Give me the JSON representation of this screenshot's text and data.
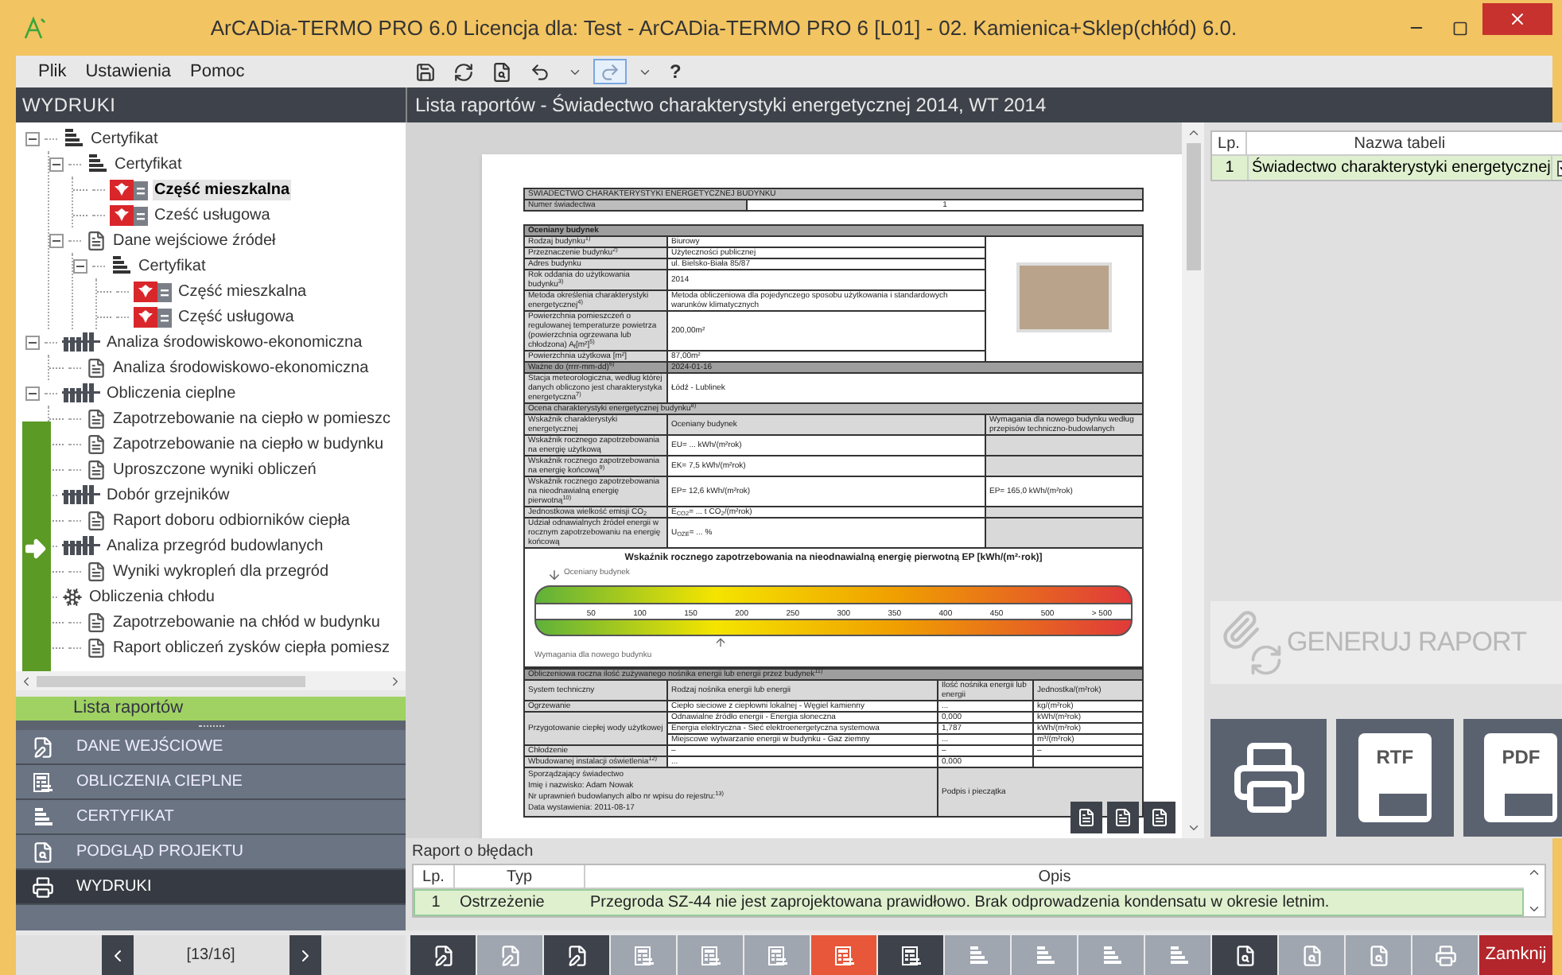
{
  "window": {
    "title": "ArCADia-TERMO PRO 6.0 Licencja dla: Test - ArCADia-TERMO PRO 6 [L01] - 02. Kamienica+Sklep(chłód) 6.0."
  },
  "menu": [
    "Plik",
    "Ustawienia",
    "Pomoc"
  ],
  "toolbar": [
    {
      "kind": "save",
      "highlighted": false
    },
    {
      "kind": "refresh",
      "highlighted": false
    },
    {
      "kind": "preview",
      "highlighted": false
    },
    {
      "kind": "undo",
      "highlighted": false
    },
    {
      "kind": "dropdown",
      "highlighted": false
    },
    {
      "kind": "redo",
      "highlighted": true
    },
    {
      "kind": "dropdown",
      "highlighted": false
    },
    {
      "kind": "help",
      "label": "?",
      "highlighted": false
    }
  ],
  "left_panel": {
    "title": "WYDRUKI",
    "tree": [
      {
        "label": "Certyfikat",
        "kind": "cert",
        "expanded": true,
        "selected": false,
        "children": [
          {
            "label": "Certyfikat",
            "kind": "cert",
            "expanded": true,
            "selected": false,
            "children": [
              {
                "label": "Część mieszkalna",
                "kind": "flag",
                "selected": true
              },
              {
                "label": "Cześć usługowa",
                "kind": "flag",
                "selected": false
              }
            ]
          },
          {
            "label": "Dane wejściowe źródeł",
            "kind": "doc",
            "expanded": true,
            "selected": false,
            "children": [
              {
                "label": "Certyfikat",
                "kind": "cert",
                "expanded": true,
                "selected": false,
                "children": [
                  {
                    "label": "Część mieszkalna",
                    "kind": "flag",
                    "selected": false
                  },
                  {
                    "label": "Część usługowa",
                    "kind": "flag",
                    "selected": false
                  }
                ]
              }
            ]
          }
        ]
      },
      {
        "label": "Analiza środowiskowo-ekonomiczna",
        "kind": "radiator",
        "expanded": true,
        "selected": false,
        "children": [
          {
            "label": "Analiza środowiskowo-ekonomiczna",
            "kind": "doc",
            "selected": false
          }
        ]
      },
      {
        "label": "Obliczenia cieplne",
        "kind": "radiator",
        "expanded": true,
        "selected": false,
        "children": [
          {
            "label": "Zapotrzebowanie na ciepło w pomieszc",
            "kind": "doc",
            "selected": false
          },
          {
            "label": "Zapotrzebowanie na ciepło w budynku",
            "kind": "doc",
            "selected": false
          },
          {
            "label": "Uproszczone wyniki obliczeń",
            "kind": "doc",
            "selected": false
          }
        ]
      },
      {
        "label": "Dobór grzejników",
        "kind": "radiator",
        "expanded": true,
        "selected": false,
        "children": [
          {
            "label": "Raport doboru odbiorników ciepła",
            "kind": "doc",
            "selected": false
          }
        ]
      },
      {
        "label": "Analiza przegród budowlanych",
        "kind": "radiator",
        "expanded": true,
        "selected": false,
        "children": [
          {
            "label": "Wyniki wykropleń dla przegród",
            "kind": "doc",
            "selected": false
          }
        ]
      },
      {
        "label": "Obliczenia chłodu",
        "kind": "snow",
        "expanded": true,
        "selected": false,
        "children": [
          {
            "label": "Zapotrzebowanie na chłód w budynku",
            "kind": "doc",
            "selected": false
          },
          {
            "label": "Raport obliczeń zysków ciepła pomiesz",
            "kind": "doc",
            "selected": false
          }
        ]
      }
    ],
    "active_section": "Lista raportów",
    "nav": [
      {
        "label": "DANE WEJŚCIOWE",
        "kind": "doc",
        "selected": false
      },
      {
        "label": "OBLICZENIA CIEPLNE",
        "kind": "calc",
        "selected": false
      },
      {
        "label": "CERTYFIKAT",
        "kind": "cert",
        "selected": false
      },
      {
        "label": "PODGLĄD PROJEKTU",
        "kind": "preview",
        "selected": false
      },
      {
        "label": "WYDRUKI",
        "kind": "print",
        "selected": true
      }
    ],
    "pager": "[13/16]"
  },
  "main": {
    "title": "Lista raportów - Świadectwo charakterystyki energetycznej 2014, WT 2014",
    "document": {
      "title": "ŚWIADECTWO CHARAKTERYSTYKI ENERGETYCZNEJ BUDYNKU",
      "number_label": "Numer świadectwa",
      "number": "1",
      "building": {
        "heading": "Oceniany budynek",
        "rows": [
          {
            "label": "Rodzaj budynku$^{1)}$",
            "value": "Biurowy"
          },
          {
            "label": "Przeznaczenie budynku$^{2)}$",
            "value": "Użyteczności publicznej"
          },
          {
            "label": "Adres budynku",
            "value": "ul. Bielsko-Biała 85/87"
          },
          {
            "label": "Rok oddania do użytkowania budynku$^{3)}$",
            "value": "2014"
          },
          {
            "label": "Metoda określenia charakterystyki energetycznej$^{4)}$",
            "value": "Metoda obliczeniowa dla pojedynczego sposobu użytkowania i standardowych warunków klimatycznych"
          },
          {
            "label": "Powierzchnia pomieszczeń o regulowanej temperaturze powietrza (powierzchnia ogrzewana lub chłodzona) A$_{f}$[m²]$^{5)}$",
            "value": "200,00m²"
          },
          {
            "label": "Powierzchnia użytkowa [m²]",
            "value": "87,00m²"
          }
        ]
      },
      "valid_until": {
        "label": "Ważne do (rrrr-mm-dd)$^{6)}$",
        "value": "2024-01-16"
      },
      "station": {
        "label": "Stacja meteorologiczna, według której danych obliczono jest charakterystyka energetyczna$^{7)}$",
        "value": "Łódź - Lublinek"
      },
      "rating": {
        "heading": "Ocena charakterystyki energetycznej budynku$^{8)}$",
        "columns": [
          "Wskaźnik charakterystyki energetycznej",
          "Oceniany budynek",
          "Wymagania dla nowego budynku według przepisów techniczno-budowlanych"
        ],
        "rows": [
          {
            "label": "Wskaźnik rocznego zapotrzebowania na energię użytkową",
            "value": "EU= ... kWh/(m²rok)"
          },
          {
            "label": "Wskaźnik rocznego zapotrzebowania na energię końcową$^{9)}$",
            "value": "EK= 7,5 kWh/(m²rok)"
          },
          {
            "label": "Wskaźnik rocznego zapotrzebowania na nieodnawialną energię pierwotną$^{10)}$",
            "value": "EP= 12,6 kWh/(m²rok)",
            "requirement": "EP= 165,0 kWh/(m²rok)"
          },
          {
            "label": "Jednostkowa wielkość emisji CO$_{2}$",
            "value": "E$_{CO2}$= ... t CO$_{2}$/(m²rok)"
          },
          {
            "label": "Udział odnawialnych źródeł energii w rocznym zapotrzebowaniu na energię końcową",
            "value": "U$_{OZE}$= ... %"
          }
        ]
      },
      "scale": {
        "title": "Wskaźnik rocznego zapotrzebowania na nieodnawialną energię pierwotną EP [kWh/(m²·rok)]",
        "building_marker": {
          "label": "Oceniany budynek",
          "level": 0.02
        },
        "requirement_marker": {
          "label": "Wymagania dla nowego budynku",
          "level": 0.3
        },
        "ticks": [
          "50",
          "100",
          "150",
          "200",
          "250",
          "300",
          "350",
          "400",
          "450",
          "500",
          "> 500"
        ]
      },
      "consumption": {
        "heading": "Obliczeniowa roczna ilość zużywanego nośnika energii lub energii przez budynek$^{11)}$",
        "columns": [
          "System techniczny",
          "Rodzaj nośnika energii lub energii",
          "Ilość nośnika energii lub energii",
          "Jednostka/(m²rok)"
        ],
        "groups": [
          {
            "system": "Ogrzewanie",
            "items": [
              {
                "carrier": "Ciepło sieciowe z ciepłowni lokalnej - Węgiel kamienny",
                "amount": "...",
                "unit": "kg/(m²rok)"
              }
            ]
          },
          {
            "system": "Przygotowanie ciepłej wody użytkowej",
            "items": [
              {
                "carrier": "Odnawialne źródło energii - Energia słoneczna",
                "amount": "0,000",
                "unit": "kWh/(m²rok)"
              },
              {
                "carrier": "Energia elektryczna - Sieć elektroenergetyczna systemowa",
                "amount": "1,787",
                "unit": "kWh/(m²rok)"
              },
              {
                "carrier": "Miejscowe wytwarzanie energii w budynku - Gaz ziemny",
                "amount": "...",
                "unit": "m³/(m²rok)"
              }
            ]
          },
          {
            "system": "Chłodzenie",
            "items": [
              {
                "carrier": "–",
                "amount": "–",
                "unit": "–"
              }
            ]
          },
          {
            "system": "Wbudowanej instalacji oświetlenia$^{12)}$",
            "items": [
              {
                "carrier": "...",
                "amount": "0,000"
              }
            ]
          }
        ]
      },
      "signature": {
        "lines": [
          "Sporządzający świadectwo",
          "Imię i nazwisko: Adam Nowak",
          "Nr uprawnień budowlanych albo nr wpisu do rejestru:$^{13)}$",
          "Data wystawienia: 2011-08-17"
        ],
        "sign_label": "Podpis i pieczątka"
      }
    }
  },
  "tables_panel": {
    "columns": [
      "Lp.",
      "Nazwa tabeli"
    ],
    "rows": [
      {
        "lp": "1",
        "name": "Świadectwo charakterystyki energetycznej",
        "checked": true,
        "selected": true
      }
    ],
    "generate_button": "GENERUJ RAPORT",
    "export_buttons": [
      {
        "kind": "print"
      },
      {
        "kind": "rtf",
        "label": "RTF"
      },
      {
        "kind": "pdf",
        "label": "PDF"
      }
    ]
  },
  "errors": {
    "title": "Raport o błędach",
    "columns": [
      "Lp.",
      "Typ",
      "Opis"
    ],
    "rows": [
      {
        "lp": "1",
        "type": "Ostrzeżenie",
        "description": "Przegroda SZ-44 nie jest zaprojektowana prawidłowo. Brak odprowadzenia kondensatu w okresie letnim."
      }
    ]
  },
  "bottom_toolbar": [
    {
      "kind": "doc",
      "dark": true,
      "selected": false
    },
    {
      "kind": "doc",
      "dark": false,
      "selected": false
    },
    {
      "kind": "doc",
      "dark": true,
      "selected": false
    },
    {
      "kind": "calc",
      "dark": false,
      "selected": false
    },
    {
      "kind": "calc",
      "dark": false,
      "selected": false
    },
    {
      "kind": "calc",
      "dark": false,
      "selected": false
    },
    {
      "kind": "calc",
      "dark": false,
      "selected": true
    },
    {
      "kind": "calc",
      "dark": true,
      "selected": false
    },
    {
      "kind": "cert",
      "dark": false,
      "selected": false
    },
    {
      "kind": "cert",
      "dark": false,
      "selected": false
    },
    {
      "kind": "cert",
      "dark": false,
      "selected": false
    },
    {
      "kind": "cert",
      "dark": false,
      "selected": false
    },
    {
      "kind": "preview",
      "dark": true,
      "selected": false
    },
    {
      "kind": "preview",
      "dark": false,
      "selected": false
    },
    {
      "kind": "preview",
      "dark": false,
      "selected": false
    },
    {
      "kind": "print",
      "dark": false,
      "selected": false
    }
  ],
  "close_button": "Zamknij"
}
